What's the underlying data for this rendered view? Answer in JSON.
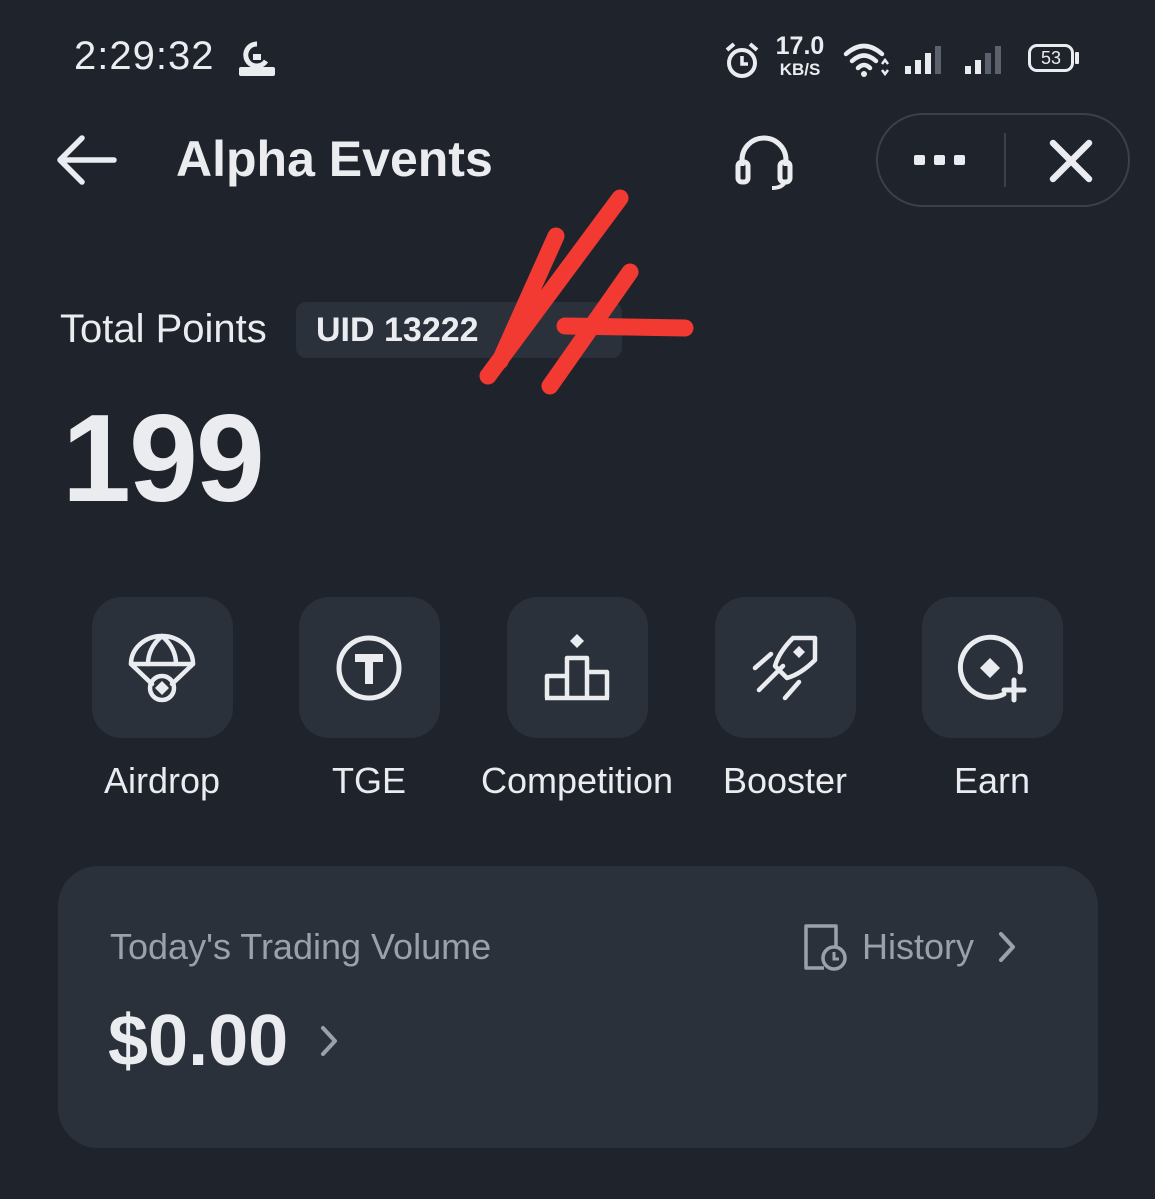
{
  "status_bar": {
    "time": "2:29:32",
    "network_speed_value": "17.0",
    "network_speed_unit": "KB/S",
    "battery": "53",
    "icons": [
      "app-notification-icon",
      "alarm-icon",
      "wifi-icon",
      "signal-icon",
      "signal-icon",
      "battery-icon"
    ]
  },
  "header": {
    "title": "Alpha Events",
    "icons": [
      "back-arrow-icon",
      "headset-support-icon",
      "more-dots-icon",
      "close-icon"
    ]
  },
  "points": {
    "label": "Total Points",
    "uid_text": "UID 13222",
    "value": "199"
  },
  "features": [
    {
      "label": "Airdrop",
      "icon": "parachute-icon"
    },
    {
      "label": "TGE",
      "icon": "token-t-icon"
    },
    {
      "label": "Competition",
      "icon": "podium-icon"
    },
    {
      "label": "Booster",
      "icon": "rocket-icon"
    },
    {
      "label": "Earn",
      "icon": "coin-plus-icon"
    }
  ],
  "trading_volume": {
    "label": "Today's Trading Volume",
    "history_label": "History",
    "value": "$0.00"
  },
  "colors": {
    "background": "#1f232b",
    "tile": "#2b313b",
    "text_primary": "#eaecef",
    "text_secondary": "#9aa1ab",
    "scribble": "#f23a33"
  }
}
